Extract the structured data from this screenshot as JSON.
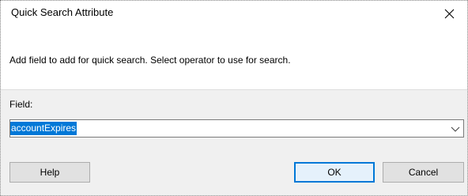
{
  "window": {
    "title": "Quick Search Attribute",
    "close_icon": "close-icon"
  },
  "dialog": {
    "description": "Add field to add for quick search. Select operator to use for search."
  },
  "field": {
    "label": "Field:",
    "value": "accountExpires",
    "dropdown_icon": "chevron-down-icon"
  },
  "buttons": {
    "help": "Help",
    "ok": "OK",
    "cancel": "Cancel"
  },
  "colors": {
    "selection": "#0078d7",
    "dialog_bg": "#f0f0f0",
    "default_button_border": "#0078d7"
  }
}
